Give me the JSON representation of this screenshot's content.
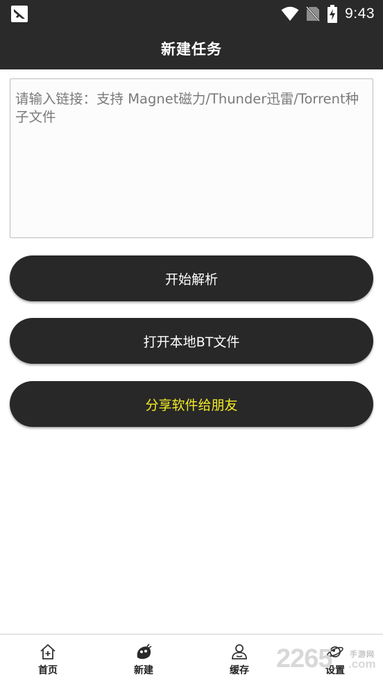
{
  "status_bar": {
    "time": "9:43"
  },
  "app_bar": {
    "title": "新建任务"
  },
  "link_input": {
    "placeholder": "请输入链接：支持 Magnet磁力/Thunder迅雷/Torrent种子文件",
    "value": ""
  },
  "buttons": {
    "parse_label": "开始解析",
    "open_bt_label": "打开本地BT文件",
    "share_label": "分享软件给朋友"
  },
  "bottom_nav": {
    "items": [
      {
        "label": "首页",
        "icon": "home-icon"
      },
      {
        "label": "新建",
        "icon": "new-task-icon"
      },
      {
        "label": "缓存",
        "icon": "cache-user-icon"
      },
      {
        "label": "设置",
        "icon": "settings-planet-icon"
      }
    ]
  },
  "watermark": {
    "number": "2265",
    "brand": "手游网",
    "domain": ".com"
  },
  "colors": {
    "bar_background": "#2a2a2a",
    "button_background": "#282828",
    "share_text": "#f3ea24",
    "button_text": "#ffffff"
  }
}
